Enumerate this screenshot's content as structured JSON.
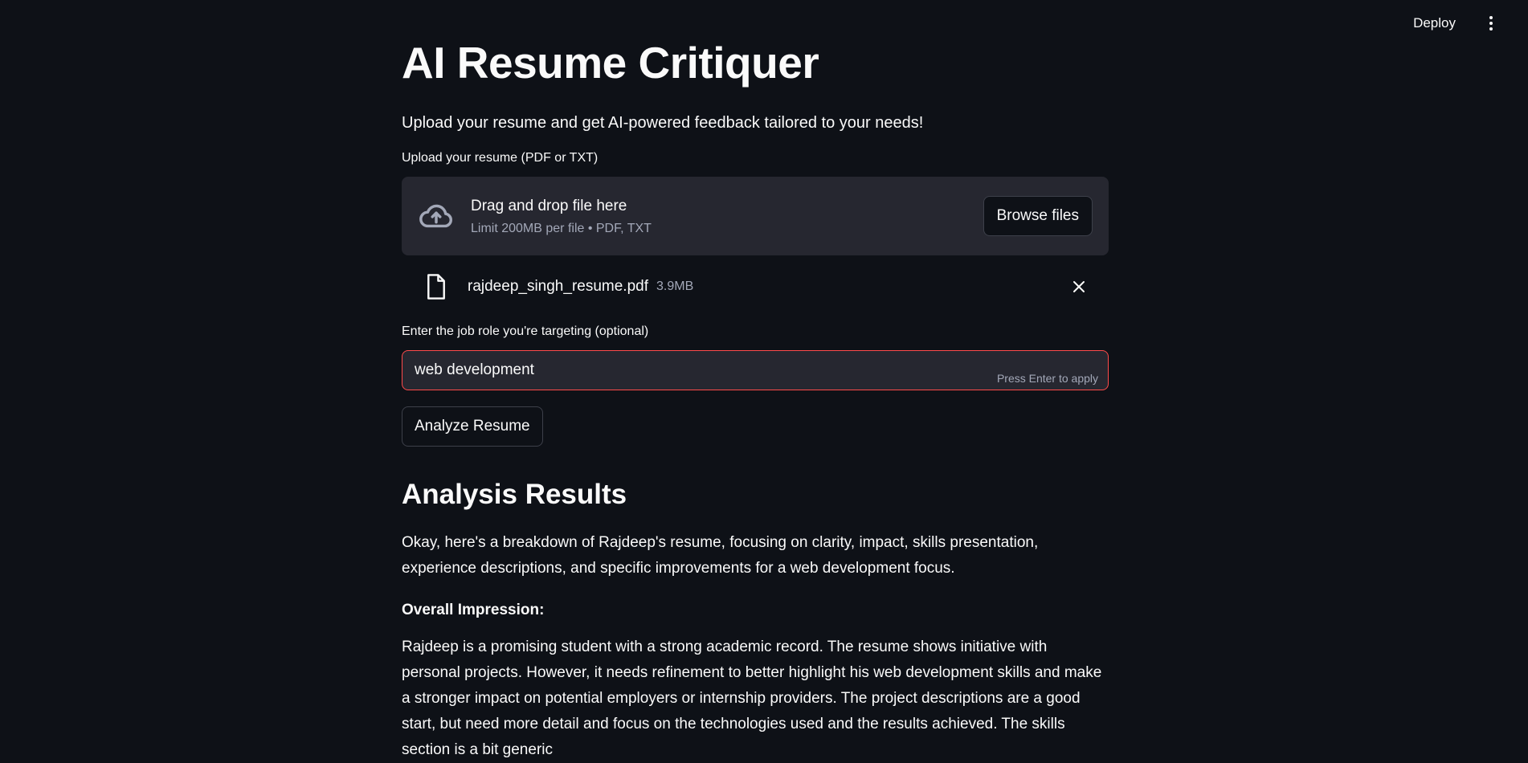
{
  "header": {
    "deploy_label": "Deploy",
    "menu_icon": "kebab-menu-icon"
  },
  "page": {
    "title": "AI Resume Critiquer",
    "subtitle": "Upload your resume and get AI-powered feedback tailored to your needs!"
  },
  "uploader": {
    "label": "Upload your resume (PDF or TXT)",
    "drag_text": "Drag and drop file here",
    "limit_text": "Limit 200MB per file • PDF, TXT",
    "browse_label": "Browse files",
    "icon": "cloud-upload-icon"
  },
  "uploaded_file": {
    "name": "rajdeep_singh_resume.pdf",
    "size": "3.9MB",
    "icon": "file-icon"
  },
  "job_role": {
    "label": "Enter the job role you're targeting (optional)",
    "value": "web development",
    "hint": "Press Enter to apply",
    "border_color": "#ff4b4b"
  },
  "analyze_button": {
    "label": "Analyze Resume"
  },
  "results": {
    "heading": "Analysis Results",
    "intro": "Okay, here's a breakdown of Rajdeep's resume, focusing on clarity, impact, skills presentation, experience descriptions, and specific improvements for a web development focus.",
    "overall_heading": "Overall Impression:",
    "overall_text": "Rajdeep is a promising student with a strong academic record. The resume shows initiative with personal projects. However, it needs refinement to better highlight his web development skills and make a stronger impact on potential employers or internship providers. The project descriptions are a good start, but need more detail and focus on the technologies used and the results achieved. The skills section is a bit generic"
  },
  "colors": {
    "background": "#0e1117",
    "surface": "#262730",
    "text": "#fafafa",
    "muted": "#a3a8b8",
    "accent": "#ff4b4b"
  }
}
